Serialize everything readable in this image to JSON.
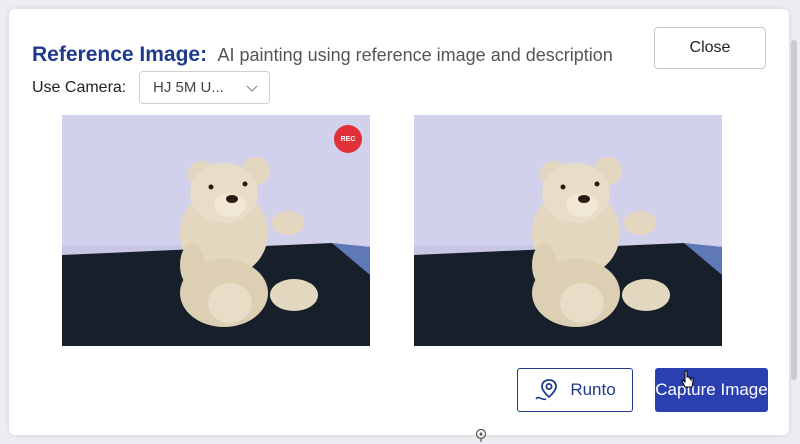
{
  "dialog": {
    "title": "Reference Image:",
    "subtitle": "AI painting using reference image and description",
    "close_label": "Close"
  },
  "camera": {
    "label": "Use Camera:",
    "selected": "HJ 5M U..."
  },
  "preview": {
    "rec_badge": "REC"
  },
  "actions": {
    "runto_label": "Runto",
    "capture_label": "Capture Image"
  },
  "colors": {
    "accent": "#1f3a8a",
    "primary_button": "#2a3fb0",
    "rec": "#e0303a"
  },
  "icons": [
    "chevron-down-icon",
    "map-pin-route-icon",
    "pointer-cursor-icon",
    "move-handle-icon"
  ]
}
